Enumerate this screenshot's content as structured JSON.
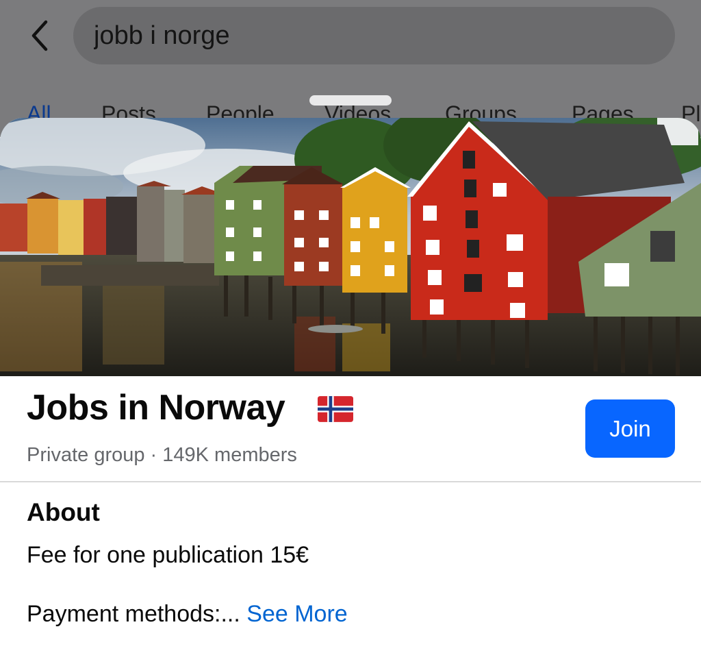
{
  "search": {
    "query": "jobb i norge"
  },
  "tabs": [
    {
      "label": "All"
    },
    {
      "label": "Posts"
    },
    {
      "label": "People"
    },
    {
      "label": "Videos"
    },
    {
      "label": "Groups"
    },
    {
      "label": "Pages"
    },
    {
      "label": "Pl"
    }
  ],
  "group": {
    "name": "Jobs in Norway",
    "meta": "Private group · 149K members",
    "join_label": "Join"
  },
  "about": {
    "title": "About",
    "fee_text": "Fee for one publication 15€",
    "payment_text": "Payment methods:...",
    "see_more_label": "See More"
  },
  "colors": {
    "accent": "#0866ff",
    "link": "#0064d1",
    "secondary_text": "#65676b"
  },
  "icons": {
    "back": "chevron-left-icon",
    "flag": "norway-flag-icon"
  }
}
